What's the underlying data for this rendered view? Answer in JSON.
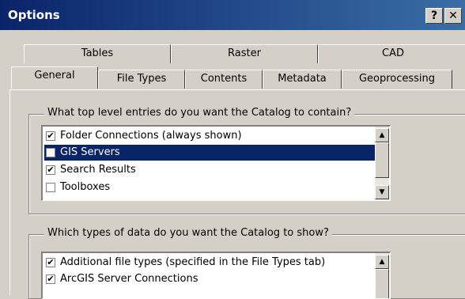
{
  "window": {
    "title": "Options",
    "help_label": "?",
    "close_label": "✕"
  },
  "tabs_row_back": [
    {
      "label": "Tables"
    },
    {
      "label": "Raster"
    },
    {
      "label": "CAD"
    }
  ],
  "tabs_row_front": [
    {
      "label": "General",
      "active": true
    },
    {
      "label": "File Types"
    },
    {
      "label": "Contents"
    },
    {
      "label": "Metadata"
    },
    {
      "label": "Geoprocessing"
    }
  ],
  "entries_group": {
    "legend": "What top level entries do you want the Catalog to contain?",
    "items": [
      {
        "label": "Folder Connections (always shown)",
        "checked": true
      },
      {
        "label": "GIS Servers",
        "checked": false,
        "selected": true
      },
      {
        "label": "Search Results",
        "checked": true
      },
      {
        "label": "Toolboxes",
        "checked": false
      }
    ]
  },
  "types_group": {
    "legend": "Which types of data do you want the Catalog to show?",
    "items": [
      {
        "label": "Additional file types (specified in the File Types tab)",
        "checked": true
      },
      {
        "label": "ArcGIS Server Connections",
        "checked": true
      }
    ]
  },
  "icons": {
    "check": "✔",
    "up": "▲",
    "down": "▼"
  },
  "colors": {
    "titlebar": "#0a246a",
    "selection": "#0a246a",
    "face": "#d4d0c8"
  }
}
